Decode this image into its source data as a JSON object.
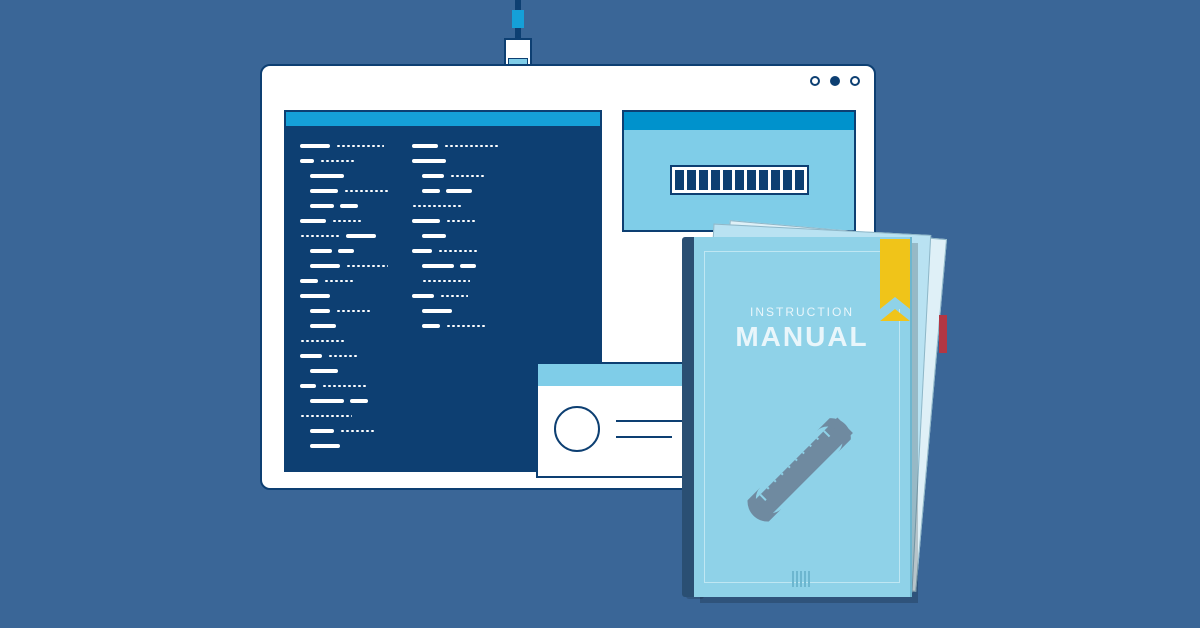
{
  "colors": {
    "bg": "#3a6697",
    "navy": "#0d3f72",
    "cyan": "#15a0d8",
    "light_cyan": "#7fcde8",
    "manual_cover": "#8fd2e8",
    "bookmark_yellow": "#f0c419",
    "bookmark_red": "#b23744"
  },
  "webcam": {
    "name": "webcam-icon"
  },
  "browser": {
    "window_controls": [
      "minimize",
      "maximize",
      "close"
    ],
    "terminal": {
      "name": "code-terminal"
    },
    "progress_panel": {
      "ticks": 11
    },
    "profile_card": {
      "name": "profile-card"
    }
  },
  "manual": {
    "subtitle": "INSTRUCTION",
    "title": "MANUAL",
    "tools": [
      "ruler",
      "wrench"
    ]
  }
}
